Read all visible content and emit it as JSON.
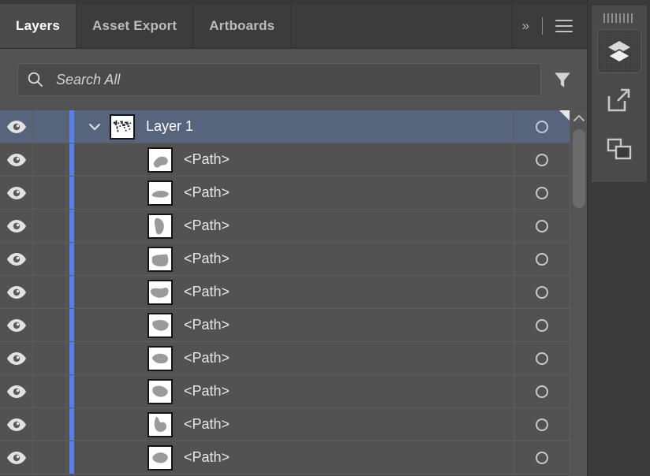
{
  "panel": {
    "tabs": [
      {
        "label": "Layers",
        "active": true
      },
      {
        "label": "Asset Export",
        "active": false
      },
      {
        "label": "Artboards",
        "active": false
      }
    ],
    "expand_label": "››",
    "menu_icon": "hamburger-menu-icon"
  },
  "search": {
    "placeholder": "Search All",
    "value": "",
    "icon": "search-icon",
    "filter_icon": "filter-funnel-icon"
  },
  "colors": {
    "panel_bg": "#3b3b3b",
    "row_bg": "#525252",
    "row_selected_bg": "#56647c",
    "selection_bar": "#5a7fea",
    "tab_active_bg": "#4a4a4a",
    "tab_inactive_bg": "#3c3c3c",
    "text": "#e8e8e8",
    "thumb_shape": "#9a9a9a"
  },
  "layers": [
    {
      "name": "Layer 1",
      "type": "layer",
      "visible": true,
      "locked": false,
      "selected": true,
      "expanded": true,
      "has_selection_marker": true,
      "thumbnail": "world-map-thumbnail"
    },
    {
      "name": "<Path>",
      "type": "path",
      "visible": true,
      "locked": false,
      "selected": false,
      "expanded": false,
      "has_selection_marker": false,
      "thumbnail": "country-shape-thumbnail"
    },
    {
      "name": "<Path>",
      "type": "path",
      "visible": true,
      "locked": false,
      "selected": false,
      "expanded": false,
      "has_selection_marker": false,
      "thumbnail": "country-shape-thumbnail"
    },
    {
      "name": "<Path>",
      "type": "path",
      "visible": true,
      "locked": false,
      "selected": false,
      "expanded": false,
      "has_selection_marker": false,
      "thumbnail": "country-shape-thumbnail"
    },
    {
      "name": "<Path>",
      "type": "path",
      "visible": true,
      "locked": false,
      "selected": false,
      "expanded": false,
      "has_selection_marker": false,
      "thumbnail": "country-shape-thumbnail"
    },
    {
      "name": "<Path>",
      "type": "path",
      "visible": true,
      "locked": false,
      "selected": false,
      "expanded": false,
      "has_selection_marker": false,
      "thumbnail": "country-shape-thumbnail"
    },
    {
      "name": "<Path>",
      "type": "path",
      "visible": true,
      "locked": false,
      "selected": false,
      "expanded": false,
      "has_selection_marker": false,
      "thumbnail": "country-shape-thumbnail"
    },
    {
      "name": "<Path>",
      "type": "path",
      "visible": true,
      "locked": false,
      "selected": false,
      "expanded": false,
      "has_selection_marker": false,
      "thumbnail": "country-shape-thumbnail"
    },
    {
      "name": "<Path>",
      "type": "path",
      "visible": true,
      "locked": false,
      "selected": false,
      "expanded": false,
      "has_selection_marker": false,
      "thumbnail": "country-shape-thumbnail"
    },
    {
      "name": "<Path>",
      "type": "path",
      "visible": true,
      "locked": false,
      "selected": false,
      "expanded": false,
      "has_selection_marker": false,
      "thumbnail": "country-shape-thumbnail"
    },
    {
      "name": "<Path>",
      "type": "path",
      "visible": true,
      "locked": false,
      "selected": false,
      "expanded": false,
      "has_selection_marker": false,
      "thumbnail": "country-shape-thumbnail"
    }
  ],
  "scrollbar": {
    "up_arrow_icon": "chevron-up-icon",
    "thumb_top_pct": 0,
    "thumb_height_pct": 24
  },
  "dock": {
    "grip": "panel-drag-grip",
    "buttons": [
      {
        "icon": "layers-stack-icon",
        "title": "Layers",
        "active": true
      },
      {
        "icon": "asset-export-icon",
        "title": "Asset Export",
        "active": false
      },
      {
        "icon": "artboards-icon",
        "title": "Artboards",
        "active": false
      }
    ]
  }
}
